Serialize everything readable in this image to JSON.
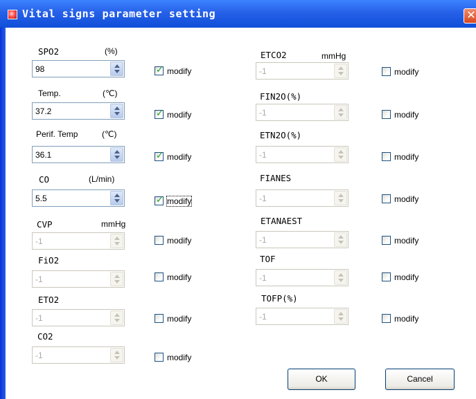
{
  "window": {
    "title": "Vital signs parameter setting",
    "close_glyph": "✕"
  },
  "checkbox_label": "modify",
  "check_glyph": "✓",
  "left_params": [
    {
      "label": "SPO2",
      "unit": "(%)",
      "value": "98",
      "enabled": true,
      "checked": true
    },
    {
      "label": "Temp.",
      "unit": "(℃)",
      "value": "37.2",
      "enabled": true,
      "checked": true
    },
    {
      "label": "Perif. Temp",
      "unit": "(℃)",
      "value": "36.1",
      "enabled": true,
      "checked": true
    },
    {
      "label": "CO",
      "unit": "(L/min)",
      "value": "5.5",
      "enabled": true,
      "checked": true
    },
    {
      "label": "CVP",
      "unit": "mmHg",
      "value": "-1",
      "enabled": false,
      "checked": false
    },
    {
      "label": "FiO2",
      "unit": "",
      "value": "-1",
      "enabled": false,
      "checked": false
    },
    {
      "label": "ETO2",
      "unit": "",
      "value": "-1",
      "enabled": false,
      "checked": false
    },
    {
      "label": "CO2",
      "unit": "",
      "value": "-1",
      "enabled": false,
      "checked": false
    }
  ],
  "right_params": [
    {
      "label": "ETCO2",
      "unit": "mmHg",
      "value": "-1",
      "enabled": false,
      "checked": false
    },
    {
      "label": "FIN2O(%)",
      "unit": "",
      "value": "-1",
      "enabled": false,
      "checked": false
    },
    {
      "label": "ETN2O(%)",
      "unit": "",
      "value": "-1",
      "enabled": false,
      "checked": false
    },
    {
      "label": "FIANES",
      "unit": "",
      "value": "-1",
      "enabled": false,
      "checked": false
    },
    {
      "label": "ETANAEST",
      "unit": "",
      "value": "-1",
      "enabled": false,
      "checked": false
    },
    {
      "label": "TOF",
      "unit": "",
      "value": "-1",
      "enabled": false,
      "checked": false
    },
    {
      "label": "TOFP(%)",
      "unit": "",
      "value": "-1",
      "enabled": false,
      "checked": false
    }
  ],
  "buttons": {
    "ok": "OK",
    "cancel": "Cancel"
  }
}
